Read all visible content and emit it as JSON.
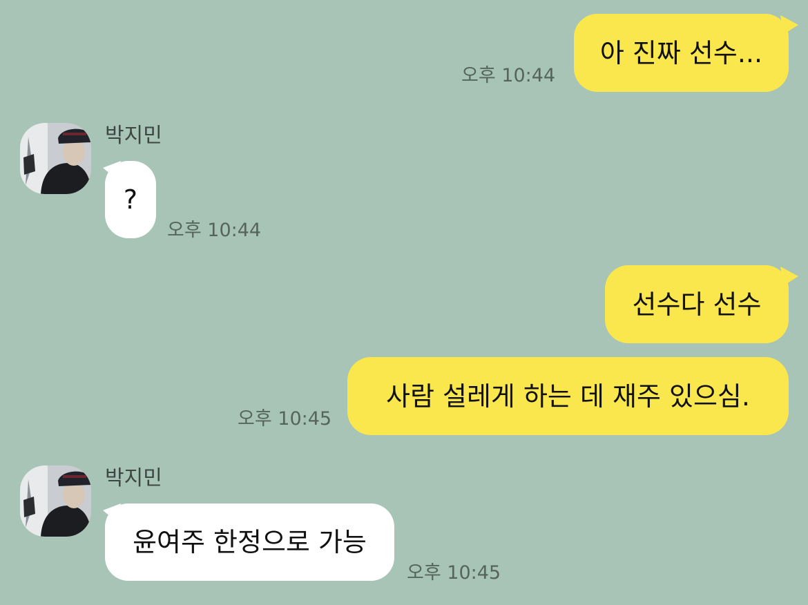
{
  "messages": [
    {
      "side": "me",
      "text": "아 진짜 선수...",
      "time": "오후 10:44"
    },
    {
      "side": "friend",
      "sender": "박지민",
      "text": "?",
      "time": "오후 10:44"
    },
    {
      "side": "me",
      "text": "선수다 선수"
    },
    {
      "side": "me",
      "text": "사람 설레게 하는 데 재주 있으심.",
      "time": "오후 10:45"
    },
    {
      "side": "friend",
      "sender": "박지민",
      "text": "윤여주 한정으로 가능",
      "time": "오후 10:45"
    }
  ],
  "colors": {
    "background": "#a7c4b6",
    "my_bubble": "#fae64d",
    "friend_bubble": "#ffffff",
    "time_text": "#55655d"
  },
  "icons": {
    "avatar": "profile-photo"
  }
}
